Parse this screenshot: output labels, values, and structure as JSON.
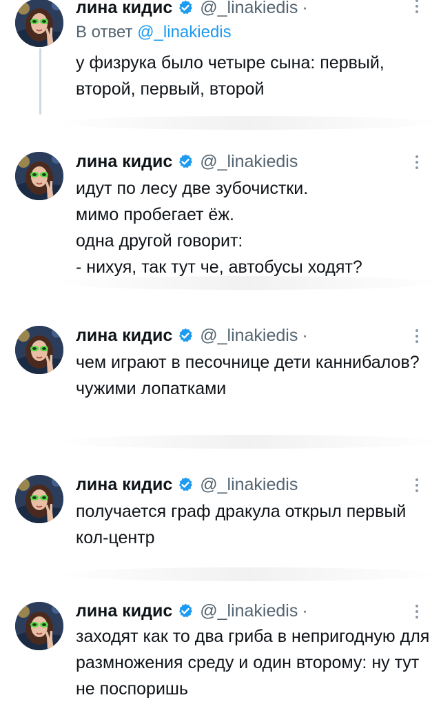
{
  "reply_to": {
    "label": "В ответ",
    "mention": "@_linakiedis"
  },
  "tweets": [
    {
      "name": "лина кидис",
      "handle": "@_linakiedis",
      "separator": "·",
      "text": "у физрука было четыре сына: первый, второй, первый, второй"
    },
    {
      "name": "лина кидис",
      "handle": "@_linakiedis",
      "separator": "",
      "text": "идут по лесу две зубочистки.\nмимо пробегает ёж.\nодна другой говорит:\n- нихуя, так тут че, автобусы ходят?"
    },
    {
      "name": "лина кидис",
      "handle": "@_linakiedis",
      "separator": "·",
      "text": "чем играют в песочнице дети каннибалов?\nчужими лопатками"
    },
    {
      "name": "лина кидис",
      "handle": "@_linakiedis",
      "separator": "",
      "text": "получается граф дракула открыл первый кол-центр"
    },
    {
      "name": "лина кидис",
      "handle": "@_linakiedis",
      "separator": "·",
      "text": "заходят как то два гриба в непригодную для размножения среду и один второму: ну тут не поспоришь"
    }
  ],
  "icons": {
    "verified": "verified-badge-icon",
    "more": "more-options-icon",
    "avatar": "profile-avatar"
  },
  "colors": {
    "accent": "#1d9bf0",
    "secondary_text": "#536471",
    "text": "#0f1419",
    "thread_line": "#cfd9de"
  }
}
